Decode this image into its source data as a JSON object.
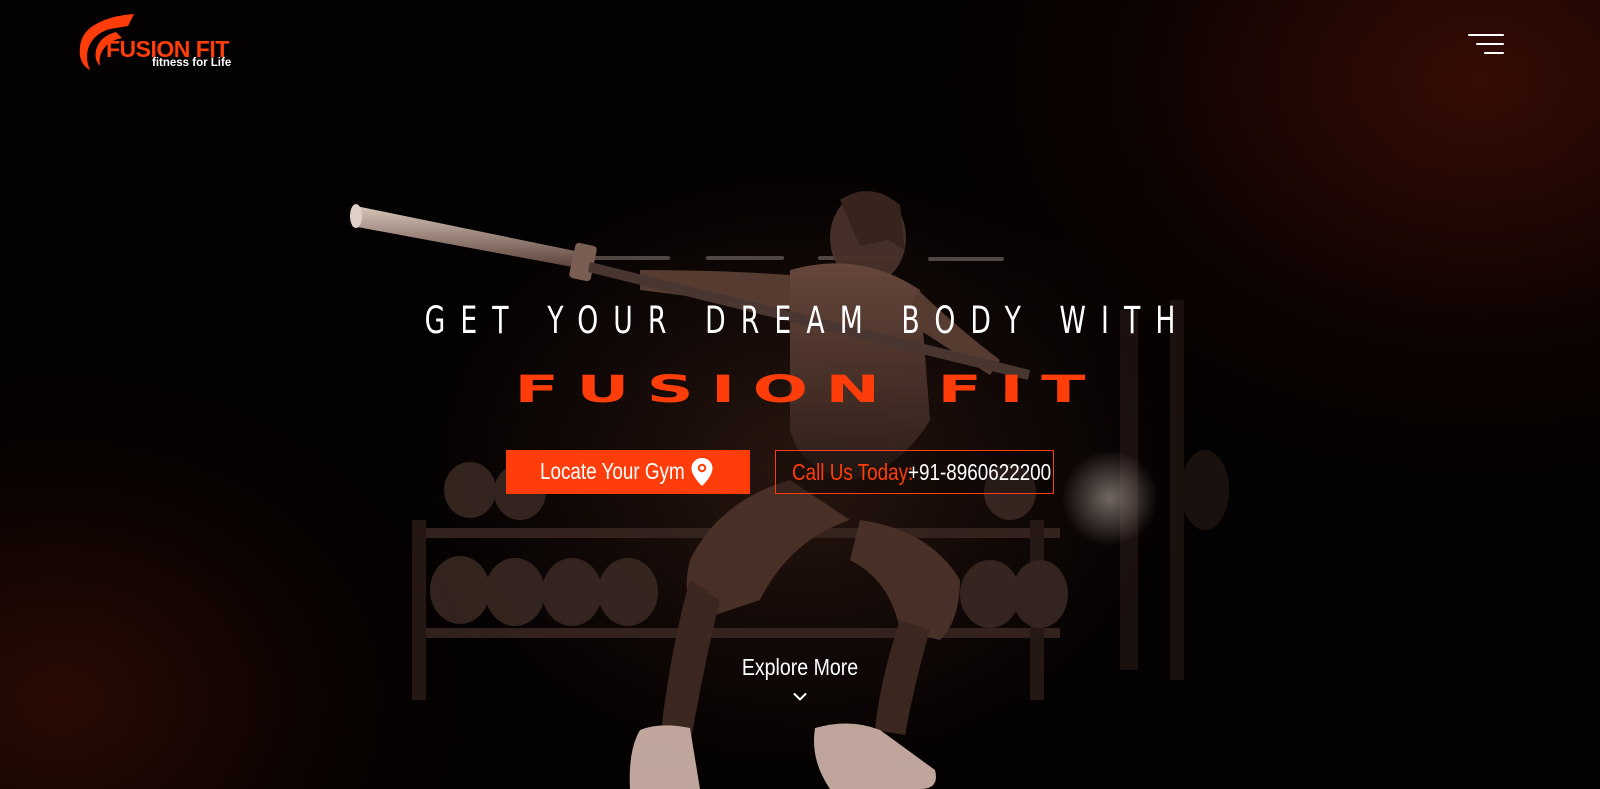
{
  "brand": {
    "name": "FUSION FIT",
    "tagline": "fitness for Life"
  },
  "header": {
    "menu_icon": "hamburger-menu-icon"
  },
  "hero": {
    "headline": "GET YOUR DREAM BODY WITH",
    "brand_title": "FUSION FIT",
    "locate_button": {
      "label": "Locate Your Gym",
      "icon": "map-pin-icon"
    },
    "call_button": {
      "label": "Call Us Today:",
      "phone": "+91-8960622200"
    },
    "explore": {
      "label": "Explore More",
      "icon": "chevron-down-icon"
    }
  },
  "colors": {
    "accent": "#ff3d0a",
    "background": "#030101",
    "text": "#ffffff"
  }
}
